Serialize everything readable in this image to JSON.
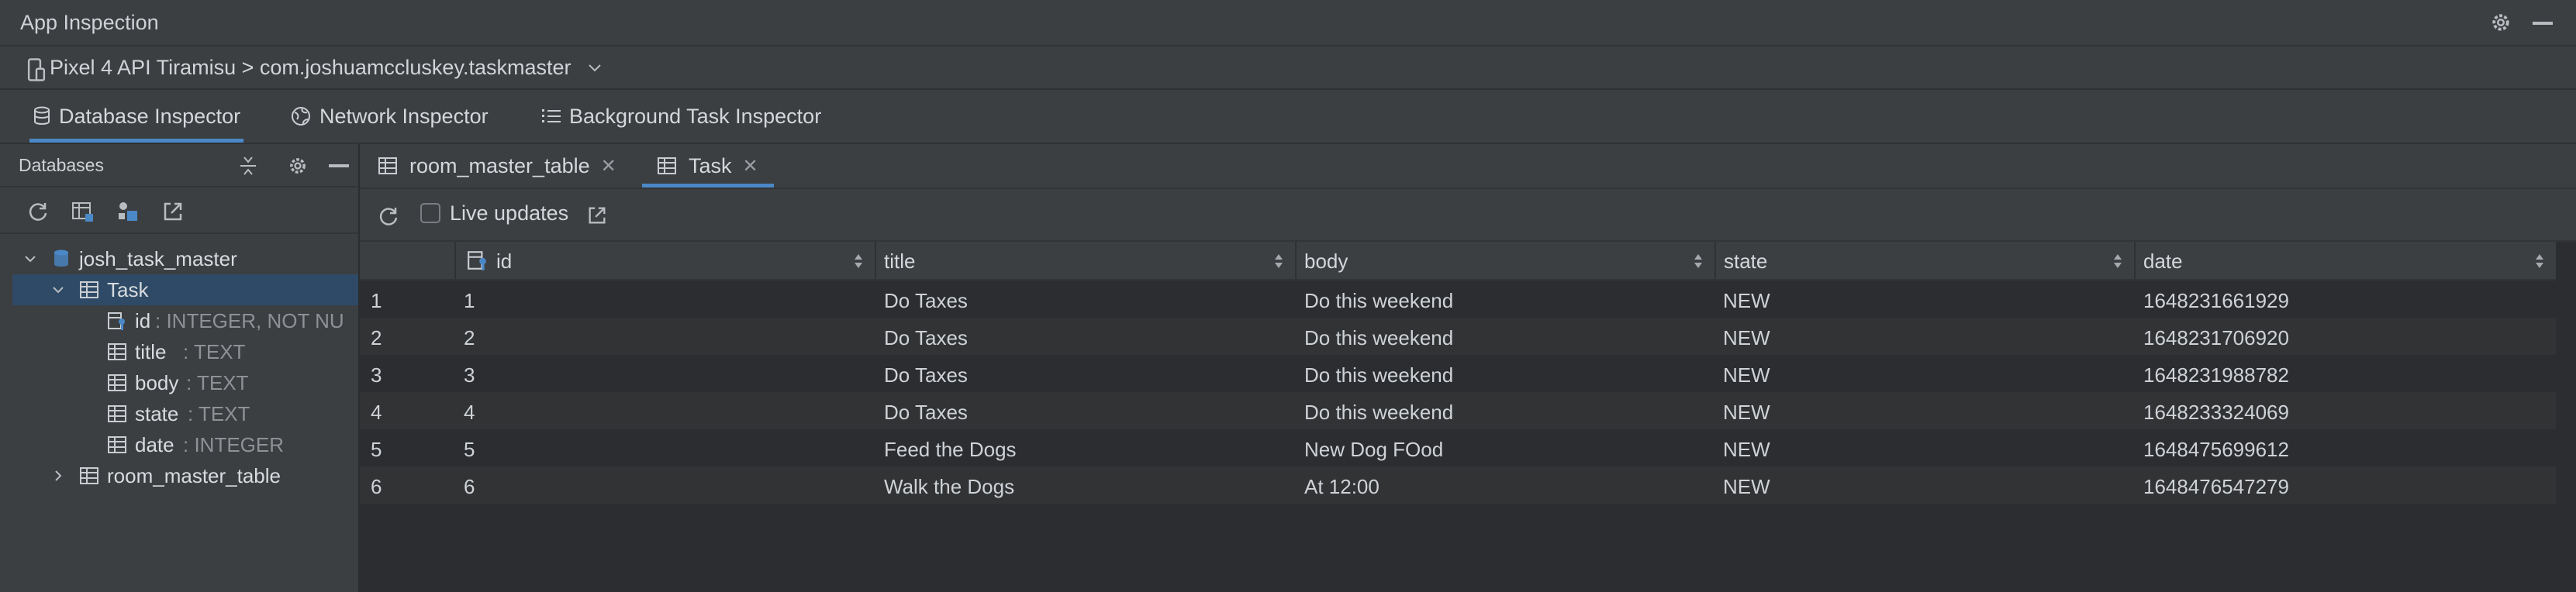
{
  "window": {
    "title": "App Inspection"
  },
  "device": {
    "selector": "Pixel 4 API Tiramisu > com.joshuamccluskey.taskmaster"
  },
  "tool_tabs": [
    {
      "label": "Database Inspector",
      "icon": "database-icon",
      "active": true
    },
    {
      "label": "Network Inspector",
      "icon": "globe-icon",
      "active": false
    },
    {
      "label": "Background Task Inspector",
      "icon": "list-icon",
      "active": false
    }
  ],
  "databases_panel": {
    "title": "Databases",
    "tree": [
      {
        "text": "josh_task_master",
        "type": "",
        "kind": "database"
      },
      {
        "text": "Task",
        "type": "",
        "kind": "table",
        "selected": true
      },
      {
        "text": "id",
        "type": " :  INTEGER, NOT NU",
        "kind": "key-column"
      },
      {
        "text": "title",
        "type": " :  TEXT",
        "kind": "column"
      },
      {
        "text": "body",
        "type": " :  TEXT",
        "kind": "column"
      },
      {
        "text": "state",
        "type": " :  TEXT",
        "kind": "column"
      },
      {
        "text": "date",
        "type": " :  INTEGER",
        "kind": "column"
      },
      {
        "text": "room_master_table",
        "type": "",
        "kind": "table"
      }
    ]
  },
  "editor_tabs": [
    {
      "label": "room_master_table",
      "active": false
    },
    {
      "label": "Task",
      "active": true
    }
  ],
  "query_toolbar": {
    "live_updates_label": "Live updates",
    "live_updates_checked": false
  },
  "table": {
    "columns": [
      "id",
      "title",
      "body",
      "state",
      "date"
    ],
    "rows": [
      {
        "n": "1",
        "id": "1",
        "title": "Do Taxes",
        "body": "Do this weekend",
        "state": "NEW",
        "date": "1648231661929"
      },
      {
        "n": "2",
        "id": "2",
        "title": "Do Taxes",
        "body": "Do this weekend",
        "state": "NEW",
        "date": "1648231706920"
      },
      {
        "n": "3",
        "id": "3",
        "title": "Do Taxes",
        "body": "Do this weekend",
        "state": "NEW",
        "date": "1648231988782"
      },
      {
        "n": "4",
        "id": "4",
        "title": "Do Taxes",
        "body": "Do this weekend",
        "state": "NEW",
        "date": "1648233324069"
      },
      {
        "n": "5",
        "id": "5",
        "title": "Feed the Dogs",
        "body": "New Dog FOod",
        "state": "NEW",
        "date": "1648475699612"
      },
      {
        "n": "6",
        "id": "6",
        "title": "Walk the Dogs",
        "body": "At 12:00",
        "state": "NEW",
        "date": "1648476547279"
      }
    ]
  }
}
